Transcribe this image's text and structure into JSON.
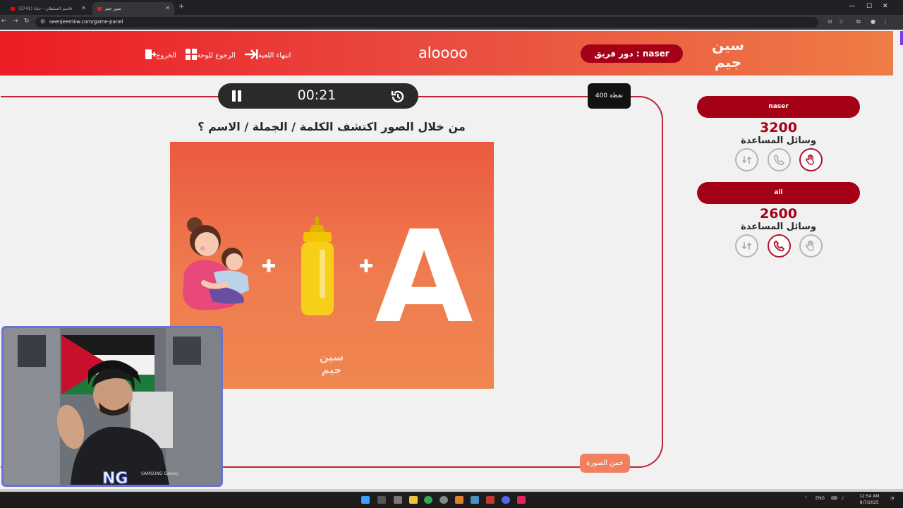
{
  "browser": {
    "tabs": [
      {
        "label": "(3741) قاسم السلطان - حياة",
        "active": false
      },
      {
        "label": "سين جيم",
        "active": true
      }
    ],
    "url": "seenjeemkw.com/game-panel"
  },
  "header": {
    "exit_label": "الخروج",
    "back_label": "الرجوع للوحة",
    "end_game_label": "انتهاء اللعبة",
    "game_title": "aloooo",
    "turn_prefix": "دور فريق :",
    "turn_team": "naser",
    "logo_text": "سين جيم"
  },
  "question_panel": {
    "timer": "00:21",
    "points": "400 نقطة",
    "question": "من خلال الصور اكتشف الكلمة / الجملة / الاسم ؟",
    "image_letter": "A",
    "image_logo_text": "سين جيم",
    "guess_button": "خمن الصورة"
  },
  "teams": [
    {
      "name": "naser",
      "score": "3200",
      "aids_label": "وسائل المساعدة",
      "aids": [
        {
          "icon": "swap-icon",
          "used": false
        },
        {
          "icon": "phone-icon",
          "used": false
        },
        {
          "icon": "hand-icon",
          "used": true
        }
      ]
    },
    {
      "name": "ali",
      "score": "2600",
      "aids_label": "وسائل المساعدة",
      "aids": [
        {
          "icon": "swap-icon",
          "used": false
        },
        {
          "icon": "phone-icon",
          "used": true
        },
        {
          "icon": "hand-icon",
          "used": false
        }
      ]
    }
  ],
  "webcam": {
    "jersey_text": "SAMSUNG Galaxy",
    "overlay_logo": "NG"
  },
  "taskbar": {
    "language": "ENG",
    "time": "12:54 AM",
    "date": "8/7/2025"
  },
  "colors": {
    "primary_red": "#a40016",
    "header_start": "#ec1c24",
    "header_end": "#ee7c45",
    "image_orange": "#eb5a40",
    "frame_red": "#c0223a"
  }
}
